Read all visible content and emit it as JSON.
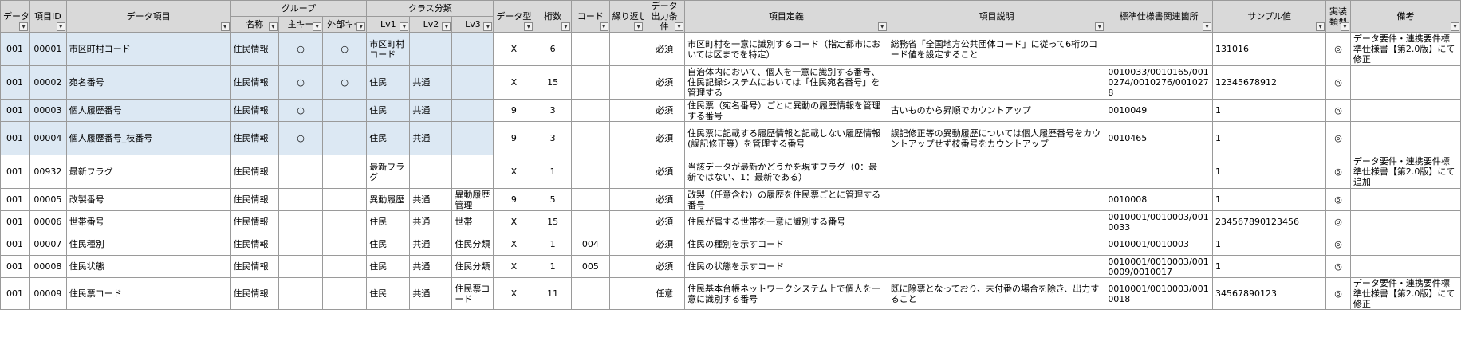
{
  "headers": {
    "data_kbn": "データ",
    "item_id": "項目ID",
    "data_item": "データ項目",
    "group": "グループ",
    "group_name": "名称",
    "group_main_key": "主キー",
    "group_ext_key": "外部キー",
    "class": "クラス分類",
    "lv1": "Lv1",
    "lv2": "Lv2",
    "lv3": "Lv3",
    "data_type": "データ型",
    "digits": "桁数",
    "code": "コード",
    "repeat": "繰り返し",
    "output_cond": "データ出力条件",
    "definition": "項目定義",
    "description": "項目説明",
    "std_ref": "標準仕様書関連箇所",
    "sample": "サンプル値",
    "impl": "実装類型",
    "remarks": "備考"
  },
  "rows": [
    {
      "d": "001",
      "id": "00001",
      "item": "市区町村コード",
      "grp": "住民情報",
      "pk": "○",
      "fk": "○",
      "lv1": "市区町村コード",
      "lv2": "",
      "lv3": "",
      "type": "X",
      "dig": "6",
      "code": "",
      "rep": "",
      "cond": "必須",
      "def": "市区町村を一意に識別するコード（指定都市においては区までを特定）",
      "desc": "総務省「全国地方公共団体コード」に従って6桁のコード値を設定すること",
      "ref": "",
      "sample": "131016",
      "impl": "◎",
      "rem": "データ要件・連携要件標準仕様書【第2.0版】にて修正",
      "hl": true
    },
    {
      "d": "001",
      "id": "00002",
      "item": "宛名番号",
      "grp": "住民情報",
      "pk": "○",
      "fk": "○",
      "lv1": "住民",
      "lv2": "共通",
      "lv3": "",
      "type": "X",
      "dig": "15",
      "code": "",
      "rep": "",
      "cond": "必須",
      "def": "自治体内において、個人を一意に識別する番号、住民記録システムにおいては「住民宛名番号」を管理する",
      "desc": "",
      "ref": "0010033/0010165/0010274/0010276/0010278",
      "sample": "12345678912",
      "impl": "◎",
      "rem": "",
      "hl": true
    },
    {
      "d": "001",
      "id": "00003",
      "item": "個人履歴番号",
      "grp": "住民情報",
      "pk": "○",
      "fk": "",
      "lv1": "住民",
      "lv2": "共通",
      "lv3": "",
      "type": "9",
      "dig": "3",
      "code": "",
      "rep": "",
      "cond": "必須",
      "def": "住民票（宛名番号）ごとに異動の履歴情報を管理する番号",
      "desc": "古いものから昇順でカウントアップ",
      "ref": "0010049",
      "sample": "1",
      "impl": "◎",
      "rem": "",
      "hl": true
    },
    {
      "d": "001",
      "id": "00004",
      "item": "個人履歴番号_枝番号",
      "grp": "住民情報",
      "pk": "○",
      "fk": "",
      "lv1": "住民",
      "lv2": "共通",
      "lv3": "",
      "type": "9",
      "dig": "3",
      "code": "",
      "rep": "",
      "cond": "必須",
      "def": "住民票に記載する履歴情報と記載しない履歴情報(誤記修正等）を管理する番号",
      "desc": "誤記修正等の異動履歴については個人履歴番号をカウントアップせず枝番号をカウントアップ",
      "ref": "0010465",
      "sample": "1",
      "impl": "◎",
      "rem": "",
      "hl": true
    },
    {
      "d": "001",
      "id": "00932",
      "item": "最新フラグ",
      "grp": "住民情報",
      "pk": "",
      "fk": "",
      "lv1": "最新フラグ",
      "lv2": "",
      "lv3": "",
      "type": "X",
      "dig": "1",
      "code": "",
      "rep": "",
      "cond": "必須",
      "def": "当該データが最新かどうかを現すフラグ（0：最新ではない、1：最新である）",
      "desc": "",
      "ref": "",
      "sample": "1",
      "impl": "◎",
      "rem": "データ要件・連携要件標準仕様書【第2.0版】にて追加",
      "hl": false
    },
    {
      "d": "001",
      "id": "00005",
      "item": "改製番号",
      "grp": "住民情報",
      "pk": "",
      "fk": "",
      "lv1": "異動履歴",
      "lv2": "共通",
      "lv3": "異動履歴管理",
      "type": "9",
      "dig": "5",
      "code": "",
      "rep": "",
      "cond": "必須",
      "def": "改製（任意含む）の履歴を住民票ごとに管理する番号",
      "desc": "",
      "ref": "0010008",
      "sample": "1",
      "impl": "◎",
      "rem": "",
      "hl": false
    },
    {
      "d": "001",
      "id": "00006",
      "item": "世帯番号",
      "grp": "住民情報",
      "pk": "",
      "fk": "",
      "lv1": "住民",
      "lv2": "共通",
      "lv3": "世帯",
      "type": "X",
      "dig": "15",
      "code": "",
      "rep": "",
      "cond": "必須",
      "def": "住民が属する世帯を一意に識別する番号",
      "desc": "",
      "ref": "0010001/0010003/0010033",
      "sample": "234567890123456",
      "impl": "◎",
      "rem": "",
      "hl": false
    },
    {
      "d": "001",
      "id": "00007",
      "item": "住民種別",
      "grp": "住民情報",
      "pk": "",
      "fk": "",
      "lv1": "住民",
      "lv2": "共通",
      "lv3": "住民分類",
      "type": "X",
      "dig": "1",
      "code": "004",
      "rep": "",
      "cond": "必須",
      "def": "住民の種別を示すコード",
      "desc": "",
      "ref": "0010001/0010003",
      "sample": "1",
      "impl": "◎",
      "rem": "",
      "hl": false
    },
    {
      "d": "001",
      "id": "00008",
      "item": "住民状態",
      "grp": "住民情報",
      "pk": "",
      "fk": "",
      "lv1": "住民",
      "lv2": "共通",
      "lv3": "住民分類",
      "type": "X",
      "dig": "1",
      "code": "005",
      "rep": "",
      "cond": "必須",
      "def": "住民の状態を示すコード",
      "desc": "",
      "ref": "0010001/0010003/0010009/0010017",
      "sample": "1",
      "impl": "◎",
      "rem": "",
      "hl": false
    },
    {
      "d": "001",
      "id": "00009",
      "item": "住民票コード",
      "grp": "住民情報",
      "pk": "",
      "fk": "",
      "lv1": "住民",
      "lv2": "共通",
      "lv3": "住民票コード",
      "type": "X",
      "dig": "11",
      "code": "",
      "rep": "",
      "cond": "任意",
      "def": "住民基本台帳ネットワークシステム上で個人を一意に識別する番号",
      "desc": "既に除票となっており、未付番の場合を除き、出力すること",
      "ref": "0010001/0010003/0010018",
      "sample": "34567890123",
      "impl": "◎",
      "rem": "データ要件・連携要件標準仕様書【第2.0版】にて修正",
      "hl": false
    }
  ]
}
